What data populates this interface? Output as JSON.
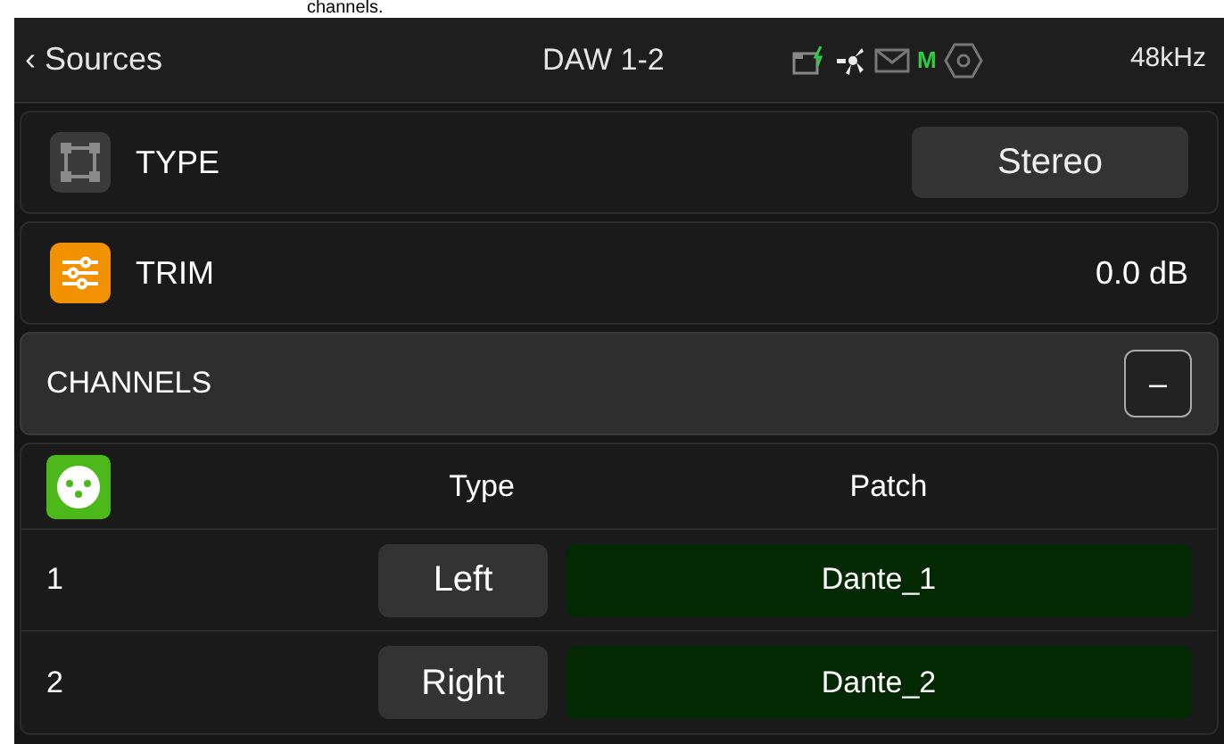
{
  "caption": "channels.",
  "header": {
    "back": "‹ Sources",
    "title": "DAW 1-2",
    "status_letter": "M",
    "sample_rate": "48kHz"
  },
  "settings": [
    {
      "kind": "select",
      "label": "TYPE",
      "value": "Stereo"
    },
    {
      "kind": "value",
      "label": "TRIM",
      "value": "0.0 dB"
    }
  ],
  "channels_section": {
    "title": "CHANNELS",
    "toggle": "–",
    "expanded": true
  },
  "table": {
    "columns": [
      "Type",
      "Patch"
    ],
    "rows": [
      {
        "number": "1",
        "type": "Left",
        "patch": "Dante_1"
      },
      {
        "number": "2",
        "type": "Right",
        "patch": "Dante_2"
      }
    ]
  }
}
